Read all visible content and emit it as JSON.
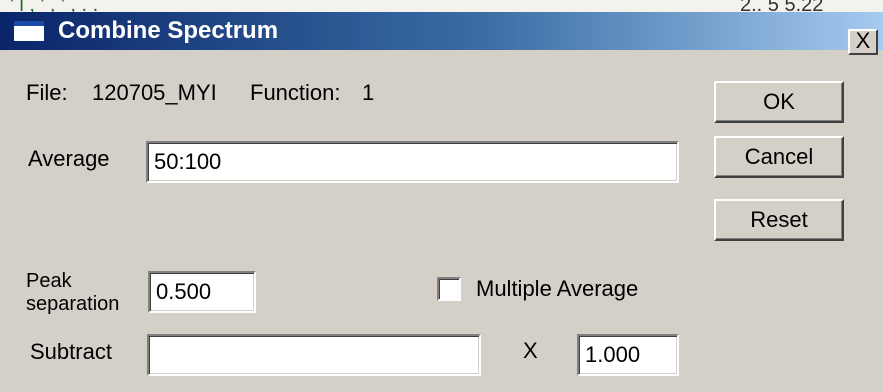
{
  "dialog": {
    "title": "Combine Spectrum",
    "close_label": "X"
  },
  "file_info": {
    "file_label": "File:",
    "file_value": "120705_MYI",
    "function_label": "Function:",
    "function_value": "1"
  },
  "average": {
    "label": "Average",
    "value": "50:100"
  },
  "peak_separation": {
    "label_line1": "Peak",
    "label_line2": "separation",
    "value": "0.500"
  },
  "multiple_average": {
    "label": "Multiple Average",
    "checked": false
  },
  "subtract": {
    "label": "Subtract",
    "value": "",
    "multiply_label": "X",
    "factor": "1.000"
  },
  "buttons": {
    "ok": "OK",
    "cancel": "Cancel",
    "reset": "Reset"
  },
  "background_fragment": {
    "text_left": "' i , ' , ' , . .",
    "text_right": "2.. 5   5.22"
  }
}
